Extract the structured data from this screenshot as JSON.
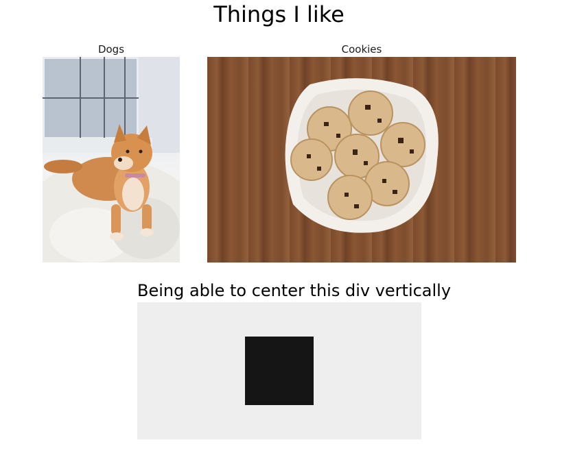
{
  "page": {
    "title": "Things I like"
  },
  "gallery": {
    "items": [
      {
        "caption": "Dogs"
      },
      {
        "caption": "Cookies"
      }
    ]
  },
  "centering": {
    "heading": "Being able to center this div vertically",
    "box_color": "#eeeeee",
    "square_color": "#151515"
  }
}
